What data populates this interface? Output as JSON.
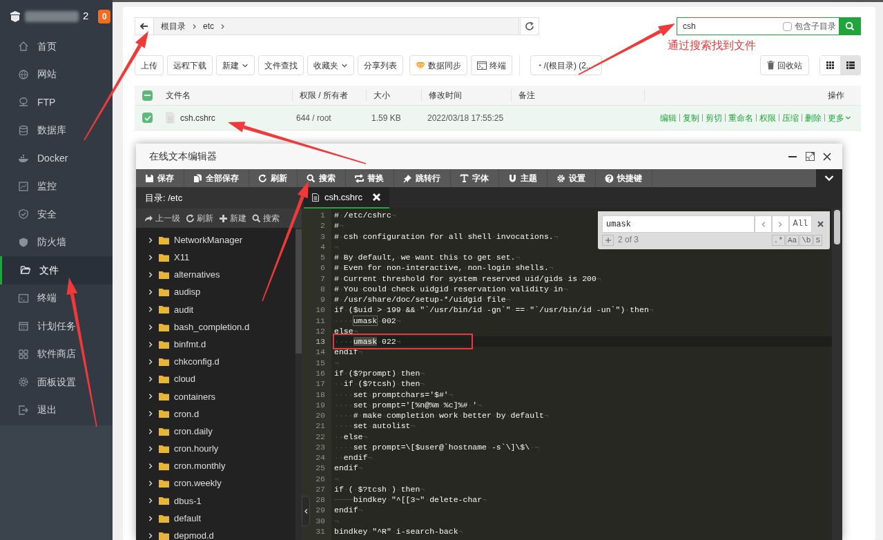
{
  "sidebar": {
    "host_suffix": "2",
    "badge": "0",
    "items": [
      {
        "label": "首页",
        "selected": false
      },
      {
        "label": "网站",
        "selected": false
      },
      {
        "label": "FTP",
        "selected": false
      },
      {
        "label": "数据库",
        "selected": false
      },
      {
        "label": "Docker",
        "selected": false
      },
      {
        "label": "监控",
        "selected": false
      },
      {
        "label": "安全",
        "selected": false
      },
      {
        "label": "防火墙",
        "selected": false
      },
      {
        "label": "文件",
        "selected": true
      },
      {
        "label": "终端",
        "selected": false
      },
      {
        "label": "计划任务",
        "selected": false
      },
      {
        "label": "软件商店",
        "selected": false
      },
      {
        "label": "面板设置",
        "selected": false
      },
      {
        "label": "退出",
        "selected": false
      }
    ]
  },
  "breadcrumb": [
    "根目录",
    "etc"
  ],
  "search": {
    "value": "csh",
    "include_subdirs_label": "包含子目录",
    "include_subdirs": false
  },
  "annotation": "通过搜索找到文件",
  "toolbar": [
    {
      "label": "上传",
      "kind": "plain"
    },
    {
      "label": "远程下载",
      "kind": "plain"
    },
    {
      "label": "新建",
      "kind": "dropdown"
    },
    {
      "label": "文件查找",
      "kind": "plain"
    },
    {
      "label": "收藏夹",
      "kind": "dropdown"
    },
    {
      "label": "分享列表",
      "kind": "plain"
    },
    {
      "label": "数据同步",
      "kind": "sync"
    },
    {
      "label": "终端",
      "kind": "terminal"
    },
    {
      "label": "/(根目录) (2...",
      "kind": "disk"
    }
  ],
  "recycle": "回收站",
  "views": [
    {
      "selected": false
    },
    {
      "selected": true
    }
  ],
  "table": {
    "select_all": {
      "indeterminate": true
    },
    "columns": [
      "文件名",
      "权限 / 所有者",
      "大小",
      "修改时间",
      "备注",
      "操作"
    ],
    "rows": [
      {
        "checked": true,
        "name": "csh.cshrc",
        "permission": "644 / root",
        "size": "1.59 KB",
        "modified": "2022/03/18 17:55:25",
        "actions": [
          "编辑",
          "复制",
          "剪切",
          "重命名",
          "权限",
          "压缩",
          "删除"
        ],
        "more": "更多"
      }
    ]
  },
  "editor": {
    "title": "在线文本编辑器",
    "toolbar": [
      "保存",
      "全部保存",
      "刷新",
      "搜索",
      "替换",
      "跳转行",
      "字体",
      "主题",
      "设置",
      "快捷键"
    ],
    "dir_label": "目录: /etc",
    "tree_toolbar": [
      "上一级",
      "刷新",
      "新建",
      "搜索"
    ],
    "tree": [
      {
        "name": "NetworkManager",
        "expanded": false
      },
      {
        "name": "X11",
        "expanded": false
      },
      {
        "name": "alternatives",
        "expanded": false
      },
      {
        "name": "audisp",
        "expanded": false
      },
      {
        "name": "audit",
        "expanded": false
      },
      {
        "name": "bash_completion.d",
        "expanded": false
      },
      {
        "name": "binfmt.d",
        "expanded": false
      },
      {
        "name": "chkconfig.d",
        "expanded": false
      },
      {
        "name": "cloud",
        "expanded": false
      },
      {
        "name": "containers",
        "expanded": false
      },
      {
        "name": "cron.d",
        "expanded": false
      },
      {
        "name": "cron.daily",
        "expanded": false
      },
      {
        "name": "cron.hourly",
        "expanded": false
      },
      {
        "name": "cron.monthly",
        "expanded": false
      },
      {
        "name": "cron.weekly",
        "expanded": false
      },
      {
        "name": "dbus-1",
        "expanded": false
      },
      {
        "name": "default",
        "expanded": false
      },
      {
        "name": "depmod.d",
        "expanded": false
      }
    ],
    "tabs": [
      {
        "label": "csh.cshrc",
        "selected": true
      }
    ],
    "find": {
      "value": "umask",
      "all": "All",
      "count": "2 of 3",
      "options": [
        ".*",
        "Aa",
        "\\b",
        "S"
      ]
    },
    "lines": [
      {
        "n": "1",
        "text": "#·/etc/cshrc¬",
        "active": false
      },
      {
        "n": "2",
        "text": "#¬",
        "active": false
      },
      {
        "n": "3",
        "text": "#·csh·configuration·for·all·shell·invocations.¬",
        "active": false
      },
      {
        "n": "4",
        "text": "¬",
        "active": false
      },
      {
        "n": "5",
        "text": "#·By·default,·we·want·this·to·get·set.¬",
        "active": false
      },
      {
        "n": "6",
        "text": "#·Even·for·non-interactive,·non-login·shells.¬",
        "active": false
      },
      {
        "n": "7",
        "text": "#·Current·threshold·for·system·reserved·uid/gids·is·200¬",
        "active": false
      },
      {
        "n": "8",
        "text": "#·You·could·check·uidgid·reservation·validity·in¬",
        "active": false
      },
      {
        "n": "9",
        "text": "#·/usr/share/doc/setup-*/uidgid·file¬",
        "active": false
      },
      {
        "n": "10",
        "text": "if·($uid·>·199·&&·\"`/usr/bin/id·-gn`\"·==·\"`/usr/bin/id·-un`\")·then¬",
        "active": false
      },
      {
        "n": "11",
        "text": "····umask·002¬",
        "active": false
      },
      {
        "n": "12",
        "text": "else¬",
        "active": false
      },
      {
        "n": "13",
        "text": "····umask·022¬",
        "active": true
      },
      {
        "n": "14",
        "text": "endif¬",
        "active": false
      },
      {
        "n": "15",
        "text": "¬",
        "active": false
      },
      {
        "n": "16",
        "text": "if·($?prompt)·then¬",
        "active": false
      },
      {
        "n": "17",
        "text": "··if·($?tcsh)·then¬",
        "active": false
      },
      {
        "n": "18",
        "text": "····set·promptchars='$#'¬",
        "active": false
      },
      {
        "n": "19",
        "text": "····set·prompt='[%n@%m·%c]%#·'¬",
        "active": false
      },
      {
        "n": "20",
        "text": "····#·make·completion·work·better·by·default¬",
        "active": false
      },
      {
        "n": "21",
        "text": "····set·autolist¬",
        "active": false
      },
      {
        "n": "22",
        "text": "··else¬",
        "active": false
      },
      {
        "n": "23",
        "text": "····set·prompt=\\[$user@`hostname·-s`\\]\\$\\·¬",
        "active": false
      },
      {
        "n": "24",
        "text": "··endif¬",
        "active": false
      },
      {
        "n": "25",
        "text": "endif¬",
        "active": false
      },
      {
        "n": "26",
        "text": "¬",
        "active": false
      },
      {
        "n": "27",
        "text": "if·(·$?tcsh·)·then¬",
        "active": false
      },
      {
        "n": "28",
        "text": "────bindkey·\"^[[3~\"·delete-char¬",
        "active": false
      },
      {
        "n": "29",
        "text": "endif¬",
        "active": false
      },
      {
        "n": "30",
        "text": "¬",
        "active": false
      },
      {
        "n": "31",
        "text": "bindkey·\"^R\"·i-search-back¬",
        "active": false
      }
    ]
  }
}
